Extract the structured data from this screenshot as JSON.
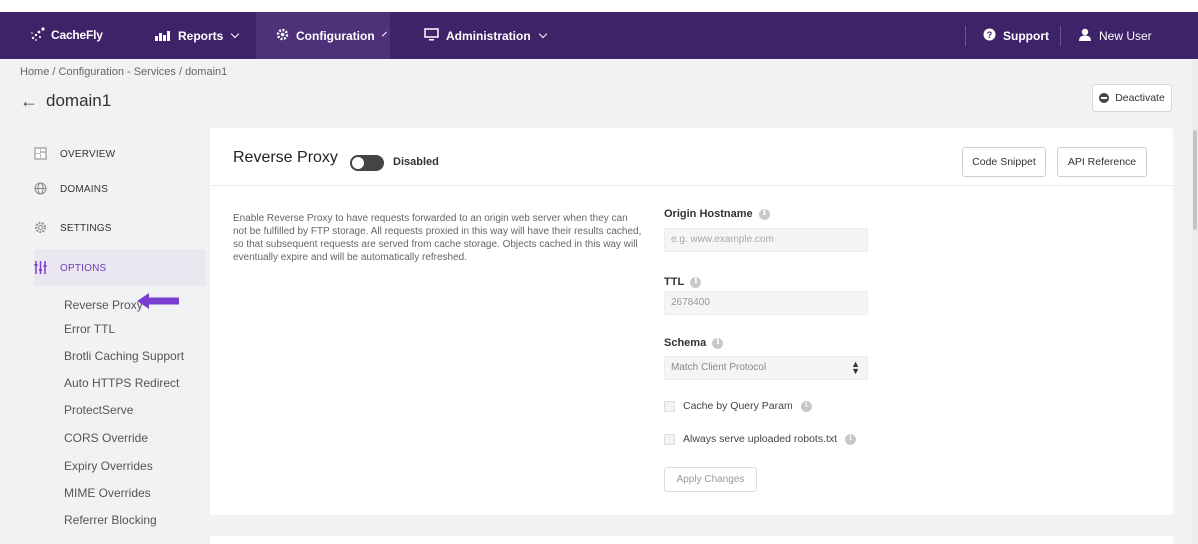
{
  "nav": {
    "logo_text": "CacheFly",
    "reports": "Reports",
    "configuration": "Configuration",
    "administration": "Administration",
    "support": "Support",
    "user": "New User"
  },
  "breadcrumb": "Home / Configuration - Services / domain1",
  "page_title": "domain1",
  "deactivate_label": "Deactivate",
  "sidebar": {
    "overview": "OVERVIEW",
    "domains": "DOMAINS",
    "settings": "SETTINGS",
    "options": "OPTIONS",
    "subitems": [
      "Reverse Proxy",
      "Error TTL",
      "Brotli Caching Support",
      "Auto HTTPS Redirect",
      "ProtectServe",
      "CORS Override",
      "Expiry Overrides",
      "MIME Overrides",
      "Referrer Blocking"
    ]
  },
  "card": {
    "title": "Reverse Proxy",
    "toggle_status": "Disabled",
    "code_snippet": "Code Snippet",
    "api_reference": "API Reference",
    "description": "Enable Reverse Proxy to have requests forwarded to an origin web server when they can not be fulfilled by FTP storage. All requests proxied in this way will have their results cached, so that subsequent requests are served from cache storage. Objects cached in this way will eventually expire and will be automatically refreshed.",
    "origin_label": "Origin Hostname",
    "origin_placeholder": "e.g. www.example.com",
    "ttl_label": "TTL",
    "ttl_value": "2678400",
    "schema_label": "Schema",
    "schema_value": "Match Client Protocol",
    "cache_query_label": "Cache by Query Param",
    "robots_label": "Always serve uploaded robots.txt",
    "apply_label": "Apply Changes"
  },
  "colors": {
    "nav_bg": "#3f2369",
    "accent": "#7a3fd0"
  }
}
